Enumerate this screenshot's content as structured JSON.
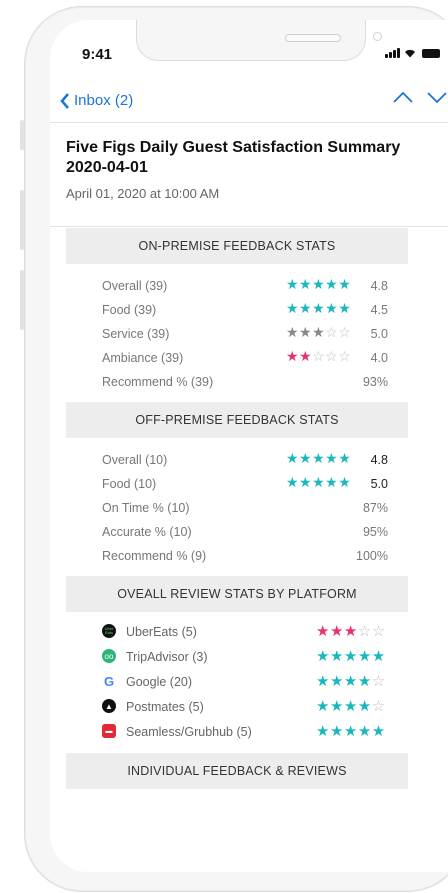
{
  "status_bar": {
    "time": "9:41"
  },
  "nav": {
    "back_label": "Inbox (2)"
  },
  "email": {
    "subject": "Five Figs Daily Guest Satisfaction Summary 2020-04-01",
    "date": "April 01, 2020 at 10:00 AM"
  },
  "colors": {
    "teal": "#19b8bd",
    "pink": "#e6326e",
    "grey": "#888888",
    "link": "#1a73d9"
  },
  "sections": {
    "on_premise": {
      "title": "ON-PREMISE FEEDBACK STATS",
      "rows": [
        {
          "label": "Overall (39)",
          "stars": "★★★★★",
          "empty": "",
          "value": "4.8",
          "star_color": "teal"
        },
        {
          "label": "Food (39)",
          "stars": "★★★★★",
          "empty": "",
          "value": "4.5",
          "star_color": "teal"
        },
        {
          "label": "Service (39)",
          "stars": "★★★",
          "empty": "☆☆",
          "value": "5.0",
          "star_color": "grey"
        },
        {
          "label": "Ambiance (39)",
          "stars": "★★",
          "empty": "☆☆☆",
          "value": "4.0",
          "star_color": "pink"
        },
        {
          "label": "Recommend % (39)",
          "stars": "",
          "empty": "",
          "value": "93%",
          "star_color": "teal"
        }
      ]
    },
    "off_premise": {
      "title": "OFF-PREMISE FEEDBACK STATS",
      "rows": [
        {
          "label": "Overall (10)",
          "stars": "★★★★★",
          "empty": "",
          "value": "4.8"
        },
        {
          "label": "Food (10)",
          "stars": "★★★★★",
          "empty": "",
          "value": "5.0"
        },
        {
          "label": "On Time % (10)",
          "stars": "",
          "empty": "",
          "value": "87%"
        },
        {
          "label": "Accurate % (10)",
          "stars": "",
          "empty": "",
          "value": "95%"
        },
        {
          "label": "Recommend % (9)",
          "stars": "",
          "empty": "",
          "value": "100%"
        }
      ]
    },
    "platforms": {
      "title": "OVEALL REVIEW STATS BY PLATFORM",
      "rows": [
        {
          "label": "UberEats (5)",
          "icon": "ubereats-icon",
          "icon_text": "Uber Eats",
          "stars": "★★★",
          "empty": "☆☆",
          "star_color": "pink"
        },
        {
          "label": "TripAdvisor (3)",
          "icon": "tripadvisor-icon",
          "icon_text": "oo",
          "stars": "★★★★★",
          "empty": "",
          "star_color": "teal"
        },
        {
          "label": "Google (20)",
          "icon": "google-icon",
          "icon_text": "G",
          "stars": "★★★★",
          "empty": "☆",
          "star_color": "teal"
        },
        {
          "label": "Postmates (5)",
          "icon": "postmates-icon",
          "icon_text": "▲",
          "stars": "★★★★",
          "empty": "☆",
          "star_color": "teal"
        },
        {
          "label": "Seamless/Grubhub (5)",
          "icon": "seamless-icon",
          "icon_text": "▬",
          "stars": "★★★★★",
          "empty": "",
          "star_color": "teal"
        }
      ]
    },
    "individual": {
      "title": "INDIVIDUAL FEEDBACK & REVIEWS"
    }
  }
}
